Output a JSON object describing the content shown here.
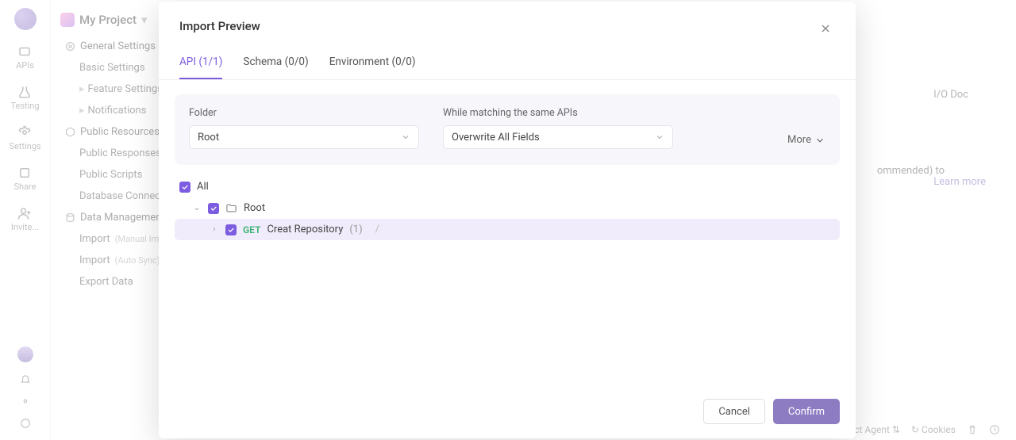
{
  "rail": {
    "apis": "APIs",
    "testing": "Testing",
    "settings": "Settings",
    "share": "Share",
    "invite": "Invite..."
  },
  "sidebar": {
    "project": "My Project",
    "groups": {
      "general": "General Settings",
      "general_items": {
        "basic": "Basic Settings",
        "feature": "Feature Settings",
        "notifications": "Notifications"
      },
      "public": "Public Resources",
      "public_items": {
        "responses": "Public Responses",
        "scripts": "Public Scripts",
        "db": "Database Connections"
      },
      "data": "Data Management",
      "data_items": {
        "import_manual": "Import",
        "import_manual_tag": "(Manual Import)",
        "import_auto": "Import",
        "import_auto_tag": "(Auto Sync)",
        "export": "Export Data"
      }
    }
  },
  "bg": {
    "iodoc": "I/O Doc",
    "recommended": "ommended)  to",
    "learnmore": "Learn more"
  },
  "statusbar": {
    "agent": "ect Agent",
    "cookies": "Cookies"
  },
  "modal": {
    "title": "Import Preview",
    "tabs": {
      "api": "API (1/1)",
      "schema": "Schema (0/0)",
      "env": "Environment (0/0)"
    },
    "options": {
      "folder_label": "Folder",
      "folder_value": "Root",
      "match_label": "While matching the same APIs",
      "match_value": "Overwrite All Fields",
      "more": "More"
    },
    "tree": {
      "all": "All",
      "root": "Root",
      "item": {
        "method": "GET",
        "name": "Creat Repository",
        "count": "(1)",
        "path": "/"
      }
    },
    "footer": {
      "cancel": "Cancel",
      "confirm": "Confirm"
    }
  }
}
